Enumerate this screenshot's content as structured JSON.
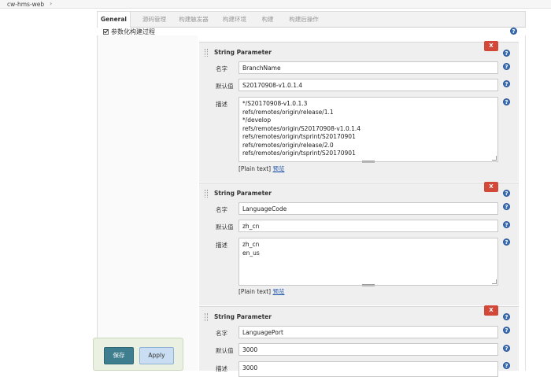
{
  "breadcrumb": {
    "item": "cw-hms-web",
    "separator": "›"
  },
  "tabs": [
    "General",
    "源码管理",
    "构建触发器",
    "构建环境",
    "构建",
    "构建后操作"
  ],
  "param_checkbox_label": "参数化构建过程",
  "labels": {
    "name": "名字",
    "default": "默认值",
    "description": "描述"
  },
  "blocks": [
    {
      "title": "String Parameter",
      "delete_label": "X",
      "name": "BranchName",
      "default": "S20170908-v1.0.1.4",
      "description_lines": [
        "*/S20170908-v1.0.1.3",
        "refs/remotes/origin/release/1.1",
        "*/develop",
        "refs/remotes/origin/S20170908-v1.0.1.4",
        "refs/remotes/origin/tsprint/S20170901",
        "refs/remotes/origin/release/2.0",
        "refs/remotes/origin/tsprint/S20170901"
      ],
      "plain_text": "[Plain text]",
      "preview": "预览"
    },
    {
      "title": "String Parameter",
      "delete_label": "X",
      "name": "LanguageCode",
      "default": "zh_cn",
      "description_lines": [
        "zh_cn",
        "en_us"
      ],
      "plain_text": "[Plain text]",
      "preview": "预览"
    },
    {
      "title": "String Parameter",
      "delete_label": "X",
      "name": "LanguagePort",
      "default": "3000",
      "description_lines": [
        "3000"
      ]
    }
  ],
  "help_glyph": "?",
  "buttons": {
    "save": "保存",
    "apply": "Apply"
  },
  "colors": {
    "delete": "#d24939",
    "save": "#3f7e8e",
    "apply": "#c9def2",
    "help": "#3b6fb6"
  }
}
